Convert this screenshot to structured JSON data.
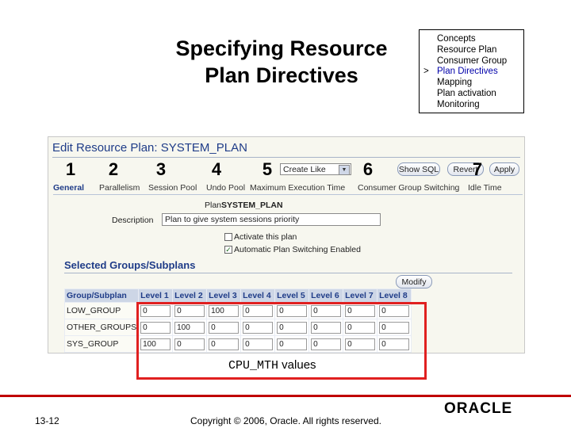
{
  "slide": {
    "title_line1": "Specifying Resource",
    "title_line2": "Plan Directives",
    "agenda": [
      "Concepts",
      "Resource Plan",
      "Consumer Group",
      "Plan Directives",
      "Mapping",
      "Plan activation",
      "Monitoring"
    ],
    "agenda_current_index": 3,
    "agenda_marker": ">",
    "callouts": [
      "1",
      "2",
      "3",
      "4",
      "5",
      "6",
      "7"
    ],
    "highlight_caption_mono": "CPU_MTH",
    "highlight_caption_text": " values",
    "slide_number": "13-12",
    "copyright": "Copyright © 2006, Oracle. All rights reserved.",
    "logo_text": "ORACLE"
  },
  "screenshot": {
    "page_title": "Edit Resource Plan: SYSTEM_PLAN",
    "tabs": [
      "General",
      "Parallelism",
      "Session Pool",
      "Undo Pool",
      "Maximum Execution Time",
      "Consumer Group Switching",
      "Idle Time"
    ],
    "active_tab": "General",
    "create_like": "Create Like",
    "buttons": [
      "Show SQL",
      "Revert",
      "Apply"
    ],
    "plan_label": "Plan",
    "plan_value": "SYSTEM_PLAN",
    "description_label": "Description",
    "description_value": "Plan to give system sessions priority",
    "checkboxes": [
      {
        "label": "Activate this plan",
        "checked": false
      },
      {
        "label": "Automatic Plan Switching Enabled",
        "checked": true
      }
    ],
    "section_title": "Selected Groups/Subplans",
    "modify_button": "Modify",
    "columns": [
      "Group/Subplan",
      "Level 1",
      "Level 2",
      "Level 3",
      "Level 4",
      "Level 5",
      "Level 6",
      "Level 7",
      "Level 8"
    ],
    "rows": [
      {
        "name": "LOW_GROUP",
        "values": [
          "0",
          "0",
          "100",
          "0",
          "0",
          "0",
          "0",
          "0"
        ]
      },
      {
        "name": "OTHER_GROUPS",
        "values": [
          "0",
          "100",
          "0",
          "0",
          "0",
          "0",
          "0",
          "0"
        ]
      },
      {
        "name": "SYS_GROUP",
        "values": [
          "100",
          "0",
          "0",
          "0",
          "0",
          "0",
          "0",
          "0"
        ]
      }
    ]
  },
  "colors": {
    "accent": "#1f3c88",
    "highlight": "#e02020",
    "footer_bar": "#c00000"
  }
}
